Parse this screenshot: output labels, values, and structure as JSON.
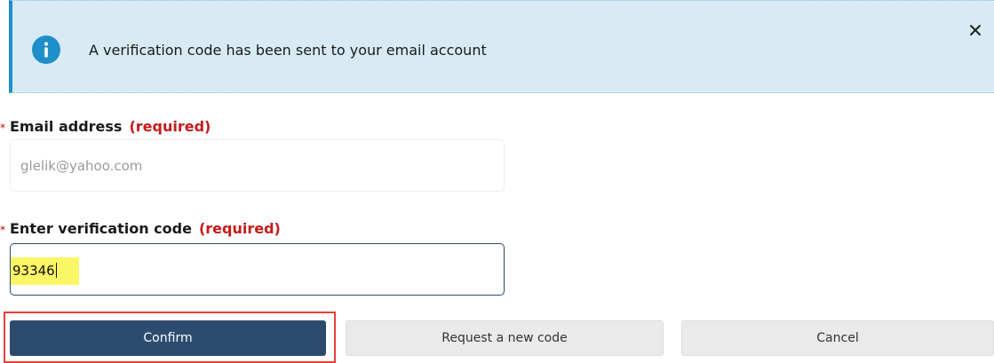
{
  "banner": {
    "message": "A verification code has been sent to your email account",
    "info_color": "#1f8fc9",
    "background": "#d8ebf5"
  },
  "email_field": {
    "asterisk": "*",
    "label": "Email address",
    "required": "(required)",
    "value": "glelik@yahoo.com"
  },
  "code_field": {
    "asterisk": "*",
    "label": "Enter verification code",
    "required": "(required)",
    "value": "93346"
  },
  "buttons": {
    "confirm": "Confirm",
    "request_new": "Request a new code",
    "cancel": "Cancel"
  },
  "icons": {
    "info": "info-icon",
    "close": "close-icon"
  },
  "colors": {
    "primary": "#2d4b6e",
    "required_text": "#c41a1a",
    "highlight": "#fbf665",
    "annotation_outline": "#e2413c"
  }
}
